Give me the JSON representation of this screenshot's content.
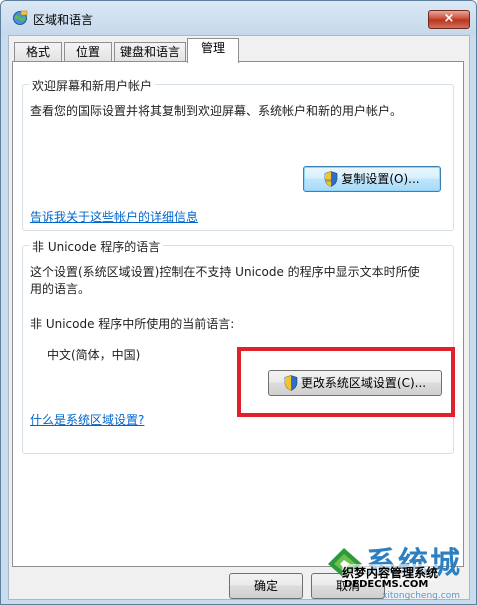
{
  "window": {
    "title": "区域和语言",
    "close_label": "×"
  },
  "tabs": [
    {
      "label": "格式"
    },
    {
      "label": "位置"
    },
    {
      "label": "键盘和语言"
    },
    {
      "label": "管理",
      "active": true
    }
  ],
  "welcome_group": {
    "title": "欢迎屏幕和新用户帐户",
    "description": "查看您的国际设置并将其复制到欢迎屏幕、系统帐户和新的用户帐户。",
    "copy_button": "复制设置(O)...",
    "link": "告诉我关于这些帐户的详细信息"
  },
  "unicode_group": {
    "title": "非 Unicode 程序的语言",
    "description_line1": "这个设置(系统区域设置)控制在不支持 Unicode 的程序中显示文本时所使",
    "description_line2": "用的语言。",
    "current_label": "非 Unicode 程序中所使用的当前语言:",
    "current_value": "中文(简体，中国)",
    "change_button": "更改系统区域设置(C)...",
    "link": "什么是系统区域设置?"
  },
  "footer": {
    "ok_button": "确定",
    "cancel_button": "取消"
  },
  "watermark": {
    "big_text": "系统城",
    "cn_text": "织梦内容管理系统",
    "url1": "DEDECMS.COM",
    "url2": "xitongcheng.com"
  },
  "colors": {
    "link": "#0066cc",
    "highlight": "#e0202a"
  }
}
